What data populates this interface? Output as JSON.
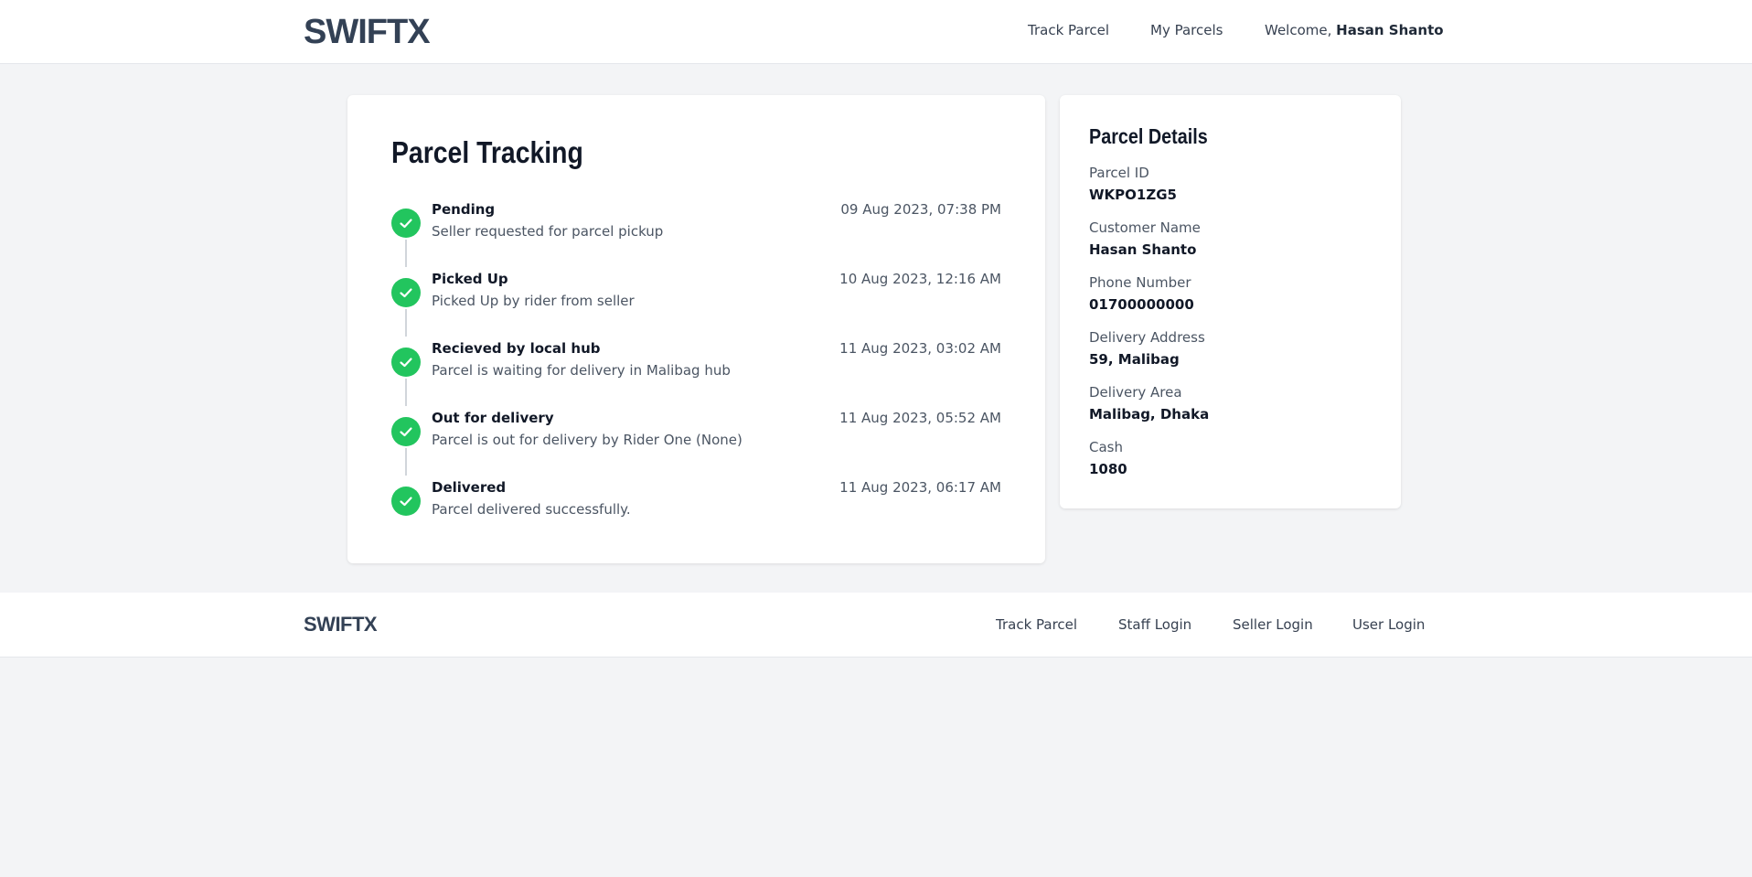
{
  "header": {
    "logo": "SWIFTX",
    "nav": {
      "track_parcel": "Track Parcel",
      "my_parcels": "My Parcels"
    },
    "welcome_prefix": "Welcome,",
    "user_name": "Hasan Shanto"
  },
  "tracking": {
    "title": "Parcel Tracking",
    "steps": [
      {
        "title": "Pending",
        "desc": "Seller requested for parcel pickup",
        "time": "09 Aug 2023, 07:38 PM",
        "icon": "check-icon"
      },
      {
        "title": "Picked Up",
        "desc": "Picked Up by rider from seller",
        "time": "10 Aug 2023, 12:16 AM",
        "icon": "check-icon"
      },
      {
        "title": "Recieved by local hub",
        "desc": "Parcel is waiting for delivery in Malibag hub",
        "time": "11 Aug 2023, 03:02 AM",
        "icon": "check-icon"
      },
      {
        "title": "Out for delivery",
        "desc": "Parcel is out for delivery by Rider One (None)",
        "time": "11 Aug 2023, 05:52 AM",
        "icon": "check-icon"
      },
      {
        "title": "Delivered",
        "desc": "Parcel delivered successfully.",
        "time": "11 Aug 2023, 06:17 AM",
        "icon": "check-icon"
      }
    ],
    "status_color": "#22c55e"
  },
  "details": {
    "title": "Parcel Details",
    "fields": [
      {
        "label": "Parcel ID",
        "value": "WKPO1ZG5"
      },
      {
        "label": "Customer Name",
        "value": "Hasan Shanto"
      },
      {
        "label": "Phone Number",
        "value": "01700000000"
      },
      {
        "label": "Delivery Address",
        "value": "59, Malibag"
      },
      {
        "label": "Delivery Area",
        "value": "Malibag, Dhaka"
      },
      {
        "label": "Cash",
        "value": "1080"
      }
    ]
  },
  "footer": {
    "logo": "SWIFTX",
    "links": {
      "track_parcel": "Track Parcel",
      "staff_login": "Staff Login",
      "seller_login": "Seller Login",
      "user_login": "User Login"
    }
  }
}
